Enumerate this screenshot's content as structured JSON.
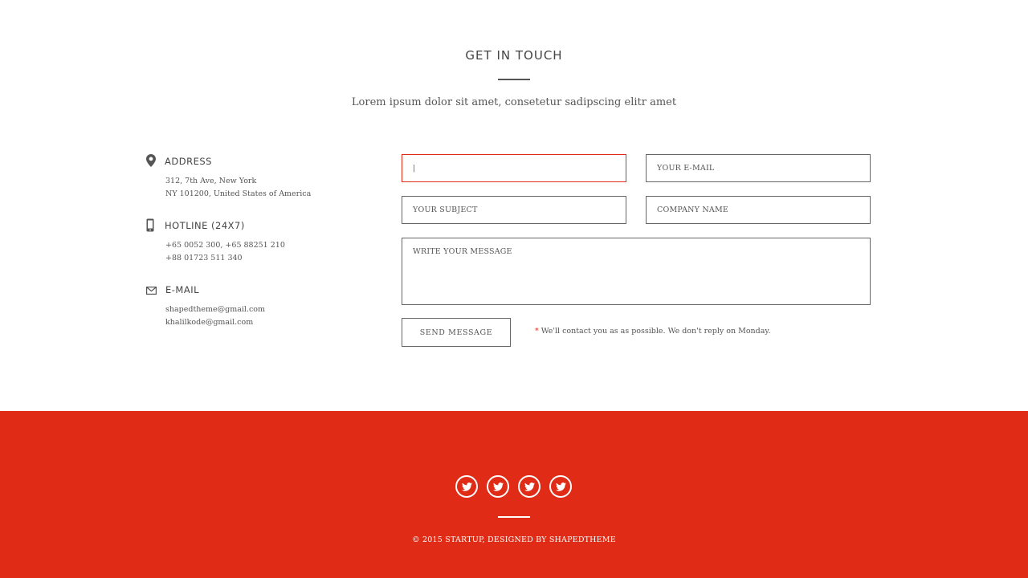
{
  "section": {
    "title": "GET IN TOUCH",
    "subtitle": "Lorem ipsum dolor sit amet, consetetur sadipscing elitr amet"
  },
  "contact_info": {
    "address": {
      "icon": "map-marker-icon",
      "heading": "ADDRESS",
      "lines": [
        "312, 7th Ave, New York",
        "NY 101200, United States of America"
      ]
    },
    "hotline": {
      "icon": "mobile-phone-icon",
      "heading": "HOTLINE (24X7)",
      "lines": [
        "+65 0052 300, +65 88251 210",
        "+88 01723 511 340"
      ]
    },
    "email": {
      "icon": "envelope-icon",
      "heading": "E-MAIL",
      "lines": [
        "shapedtheme@gmail.com",
        "khalilkode@gmail.com"
      ]
    }
  },
  "form": {
    "name_value": "|",
    "email_placeholder": "YOUR E-MAIL",
    "subject_placeholder": "YOUR SUBJECT",
    "company_placeholder": "COMPANY NAME",
    "message_placeholder": "WRITE YOUR MESSAGE",
    "send_label": "SEND MESSAGE",
    "note_star": "*",
    "note": "We'll contact you as as possible. We don't reply on Monday."
  },
  "footer": {
    "social": [
      "twitter-icon",
      "twitter-icon",
      "twitter-icon",
      "twitter-icon"
    ],
    "copyright": "© 2015 STARTUP, DESIGNED BY SHAPEDTHEME"
  },
  "colors": {
    "accent": "#e02b16",
    "text": "#555555"
  }
}
